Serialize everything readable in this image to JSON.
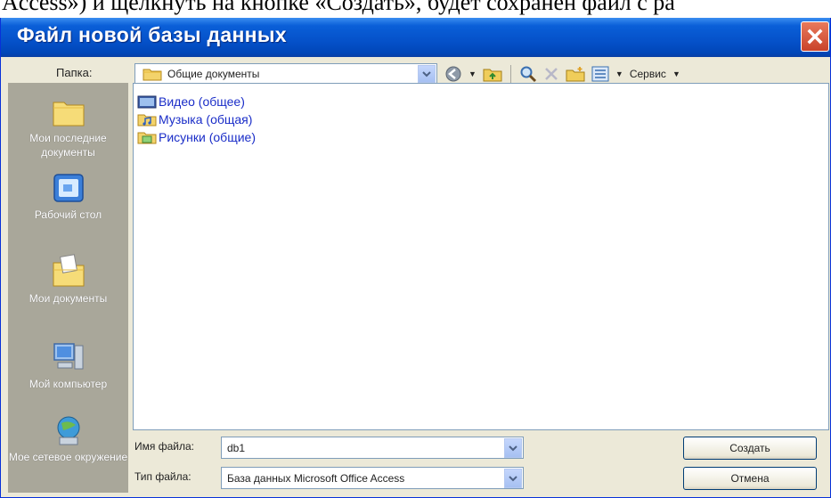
{
  "document": {
    "cropped_text": "Access») и щелкнуть на кнопке «Создать», будет сохранен файл с ра"
  },
  "window": {
    "title": "Файл новой базы данных",
    "close_icon": "close-icon"
  },
  "toolbar": {
    "folder_label": "Папка:",
    "folder_value": "Общие документы",
    "tools_label": "Сервис",
    "icons": [
      "back-icon",
      "up-folder-icon",
      "search-web-icon",
      "delete-icon",
      "new-folder-icon",
      "views-icon"
    ]
  },
  "places": [
    {
      "label": "Мои последние документы",
      "icon": "recent-documents-icon"
    },
    {
      "label": "Рабочий стол",
      "icon": "desktop-icon"
    },
    {
      "label": "Мои документы",
      "icon": "my-documents-icon"
    },
    {
      "label": "Мой компьютер",
      "icon": "my-computer-icon"
    },
    {
      "label": "Мое сетевое окружение",
      "icon": "network-places-icon"
    }
  ],
  "files": [
    {
      "label": "Видео (общее)",
      "icon": "video-folder-icon"
    },
    {
      "label": "Музыка (общая)",
      "icon": "music-folder-icon"
    },
    {
      "label": "Рисунки (общие)",
      "icon": "pictures-folder-icon"
    }
  ],
  "bottom": {
    "filename_label": "Имя файла:",
    "filename_value": "db1",
    "filetype_label": "Тип файла:",
    "filetype_value": "База данных Microsoft Office Access",
    "create_button": "Создать",
    "cancel_button": "Отмена"
  },
  "colors": {
    "titlebar": "#0551c9",
    "close_button": "#d9553a",
    "places_bar": "#a9a79a",
    "link_text": "#1a2dc8",
    "dialog_bg": "#ece9d8"
  }
}
